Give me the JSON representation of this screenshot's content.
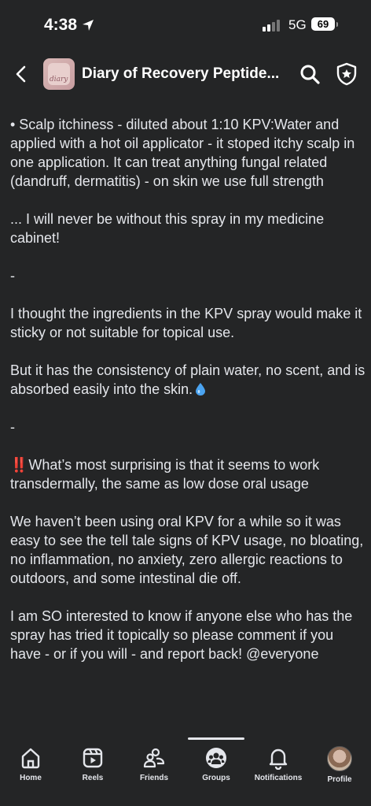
{
  "status": {
    "time": "4:38",
    "network": "5G",
    "battery": "69"
  },
  "header": {
    "group_title": "Diary of Recovery Peptide...",
    "thumb_text": "diary"
  },
  "post": {
    "paragraphs": [
      "• Scalp itchiness - diluted about 1:10 KPV:Water and applied with a hot oil applicator - it stoped itchy scalp in one application. It can treat anything fungal related (dandruff, dermatitis) - on skin we use full strength",
      "... I will never be without this spray in my medicine cabinet!",
      "-",
      "I thought the ingredients in the KPV spray would make it sticky or not suitable for topical use.",
      "But it has the consistency of plain water, no scent, and is absorbed easily into the skin.",
      "-",
      "What’s most surprising is that it seems to work transdermally, the same as low dose oral usage",
      "We haven’t been using oral KPV for a while so it was easy to see the tell tale signs of KPV usage, no bloating, no inflammation, no anxiety, zero allergic reactions to outdoors, and some intestinal die off.",
      "I am SO interested to know if anyone else who has the spray has tried it topically so please comment if you have - or if you will - and report back! @everyone"
    ],
    "bangbang": "‼️"
  },
  "tabs": [
    {
      "label": "Home",
      "icon": "home-icon"
    },
    {
      "label": "Reels",
      "icon": "reels-icon"
    },
    {
      "label": "Friends",
      "icon": "friends-icon"
    },
    {
      "label": "Groups",
      "icon": "groups-icon",
      "active": true
    },
    {
      "label": "Notifications",
      "icon": "bell-icon"
    },
    {
      "label": "Profile",
      "icon": "avatar"
    }
  ],
  "colors": {
    "background": "#242526",
    "text": "#e4e6eb",
    "accent": "#e02020"
  }
}
